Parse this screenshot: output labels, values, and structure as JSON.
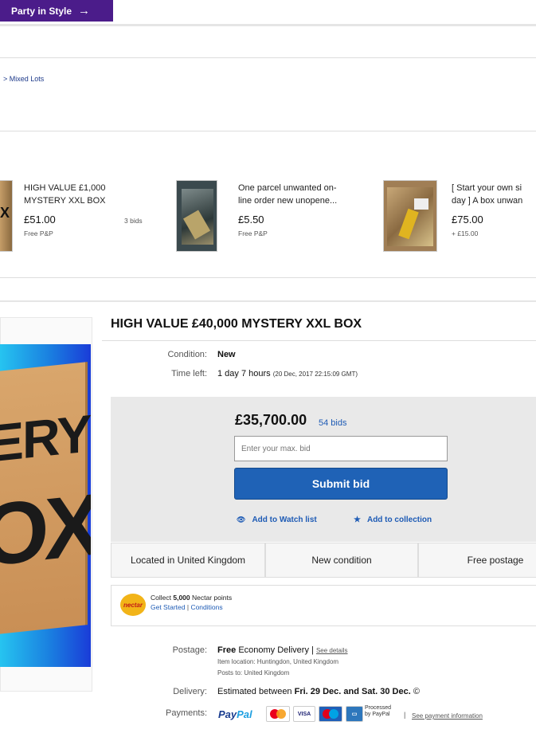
{
  "banner": {
    "promo_label": "Party in Style"
  },
  "breadcrumb": {
    "text": "> Mixed Lots"
  },
  "recommended": [
    {
      "title_line1": "HIGH VALUE £1,000",
      "title_line2": "MYSTERY XXL BOX",
      "price": "£51.00",
      "shipping": "Free P&P",
      "bids": "3 bids"
    },
    {
      "title_line1": "One parcel unwanted on-",
      "title_line2": "line order new unopene...",
      "price": "£5.50",
      "shipping": "Free P&P"
    },
    {
      "title_line1": "[ Start your own si",
      "title_line2": "day ] A box unwan",
      "price": "£75.00",
      "shipping": "+ £15.00"
    }
  ],
  "main_image": {
    "text_line1": "ERY",
    "text_line2": "OX"
  },
  "item": {
    "title": "HIGH VALUE £40,000 MYSTERY XXL BOX",
    "condition_label": "Condition:",
    "condition_value": "New",
    "time_left_label": "Time left:",
    "time_left_value": "1 day 7 hours",
    "time_left_detail": "(20 Dec, 2017   22:15:09 GMT)"
  },
  "bid": {
    "price": "£35,700.00",
    "bids_count": "54 bids",
    "input_placeholder": "Enter your max. bid",
    "submit_label": "Submit bid",
    "watch_label": "Add to Watch list",
    "collection_label": "Add to collection"
  },
  "features": {
    "location": "Located in United Kingdom",
    "condition": "New condition",
    "postage": "Free postage"
  },
  "nectar": {
    "logo_text": "nectar",
    "collect_prefix": "Collect",
    "points": "5,000",
    "collect_suffix": "Nectar points",
    "get_started": "Get Started",
    "separator": "|",
    "conditions": "Conditions"
  },
  "postage": {
    "label": "Postage:",
    "free": "Free",
    "service": "Economy Delivery",
    "separator": "|",
    "see_details": "See details",
    "item_location": "Item location:  Huntingdon, United Kingdom",
    "posts_to": "Posts to:  United Kingdom"
  },
  "delivery": {
    "label": "Delivery:",
    "prefix": "Estimated between",
    "range": "Fri. 29 Dec. and Sat. 30 Dec.",
    "info_icon": "©"
  },
  "payments": {
    "label": "Payments:",
    "paypal_pay": "Pay",
    "paypal_pal": "Pal",
    "card_visa": "VISA",
    "processed_line1": "Processed",
    "processed_line2": "by PayPal",
    "separator": "|",
    "see_payment": "See payment information"
  },
  "colors": {
    "promo": "#4b1c8a",
    "submit": "#1f62b6",
    "link": "#1e5bb5"
  }
}
